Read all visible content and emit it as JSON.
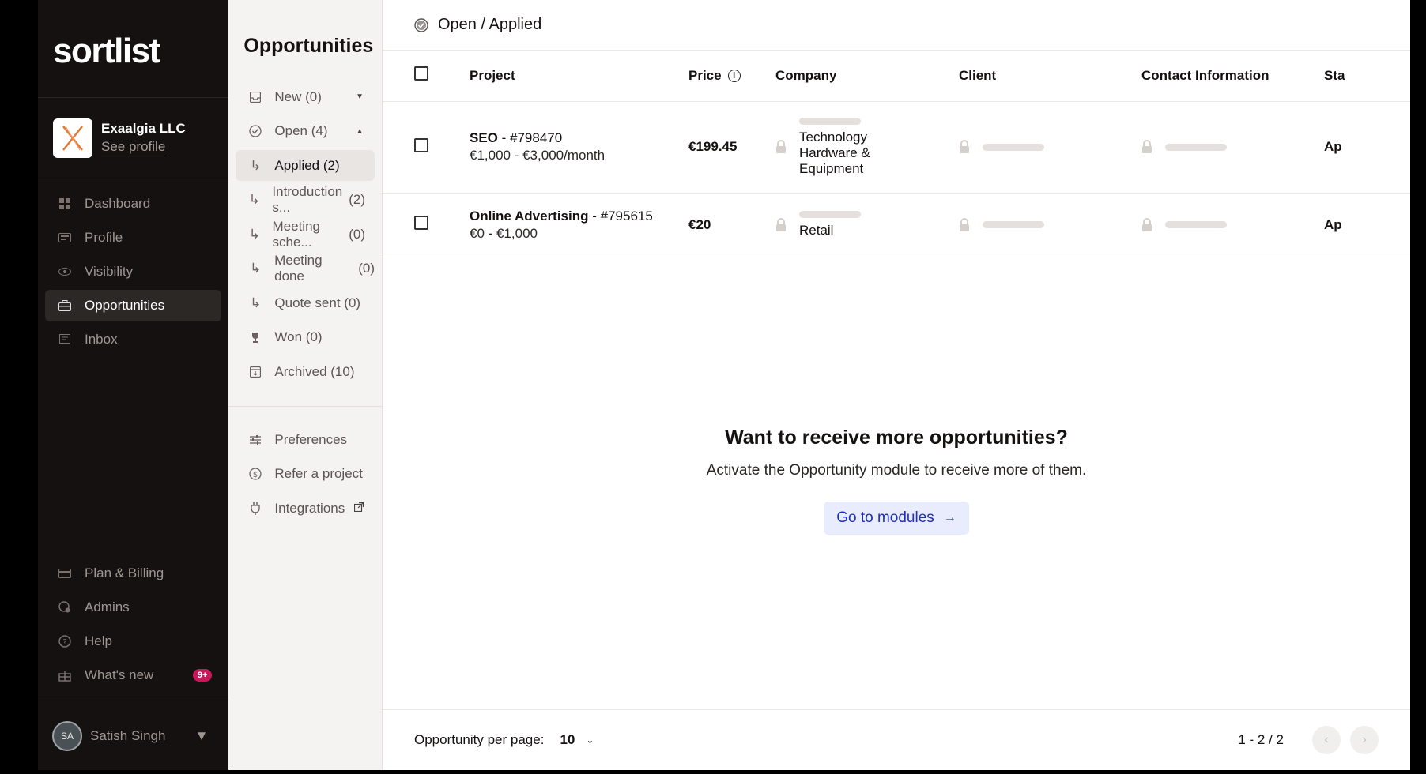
{
  "brand": {
    "logo_text": "sortlist"
  },
  "company": {
    "name": "Exaalgia LLC",
    "see_profile": "See profile"
  },
  "nav": {
    "items": [
      {
        "label": "Dashboard",
        "icon": "dashboard-icon"
      },
      {
        "label": "Profile",
        "icon": "profile-card-icon"
      },
      {
        "label": "Visibility",
        "icon": "eye-icon"
      },
      {
        "label": "Opportunities",
        "icon": "briefcase-icon",
        "active": true
      },
      {
        "label": "Inbox",
        "icon": "chat-icon"
      }
    ],
    "bottom": [
      {
        "label": "Plan & Billing",
        "icon": "credit-card-icon"
      },
      {
        "label": "Admins",
        "icon": "admins-icon"
      },
      {
        "label": "Help",
        "icon": "help-icon"
      },
      {
        "label": "What's new",
        "icon": "gift-icon",
        "badge": "9+"
      }
    ]
  },
  "user": {
    "initials": "SA",
    "name": "Satish Singh"
  },
  "opportunities": {
    "title": "Opportunities",
    "items": [
      {
        "label": "New",
        "count": "(0)"
      },
      {
        "label": "Open",
        "count": "(4)"
      },
      {
        "label": "Applied",
        "count": "(2)"
      },
      {
        "label": "Introduction s...",
        "count": "(2)"
      },
      {
        "label": "Meeting sche...",
        "count": "(0)"
      },
      {
        "label": "Meeting done",
        "count": "(0)"
      },
      {
        "label": "Quote sent",
        "count": "(0)"
      },
      {
        "label": "Won",
        "count": "(0)"
      },
      {
        "label": "Archived",
        "count": "(10)"
      }
    ],
    "extra": [
      {
        "label": "Preferences"
      },
      {
        "label": "Refer a project"
      },
      {
        "label": "Integrations"
      }
    ]
  },
  "header": {
    "breadcrumb": "Open / Applied"
  },
  "table": {
    "columns": [
      "Project",
      "Price",
      "Company",
      "Client",
      "Contact Information",
      "Sta"
    ],
    "rows": [
      {
        "service": "SEO",
        "id": " - #798470",
        "range": "€1,000 - €3,000/month",
        "price": "€199.45",
        "company_line1": "Technology",
        "company_line2": "Hardware &",
        "company_line3": "Equipment",
        "status": "Ap"
      },
      {
        "service": "Online Advertising",
        "id": " - #795615",
        "range": "€0 - €1,000",
        "price": "€20",
        "company_line1": "Retail",
        "status": "Ap"
      }
    ]
  },
  "promo": {
    "title": "Want to receive more opportunities?",
    "text": "Activate the Opportunity module to receive more of them.",
    "button": "Go to modules"
  },
  "footer": {
    "per_page_label": "Opportunity per page:",
    "per_page_value": "10",
    "range": "1 - 2 / 2"
  },
  "colors": {
    "sidebar_bg": "#141110",
    "accent_button_bg": "#e8ecfd",
    "accent_button_text": "#1c2fbf",
    "badge": "#c8185a"
  }
}
